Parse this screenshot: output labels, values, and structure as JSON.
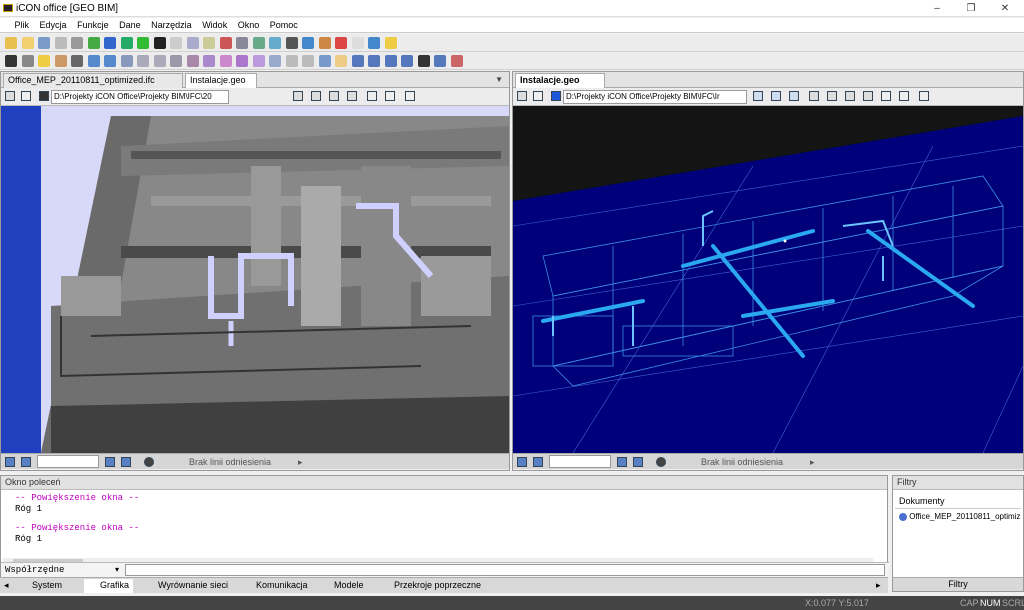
{
  "app": {
    "title": "iCON office [GEO BIM]"
  },
  "window_controls": {
    "min": "–",
    "max": "❐",
    "close": "✕"
  },
  "menu": [
    "Plik",
    "Edycja",
    "Funkcje",
    "Dane",
    "Narzędzia",
    "Widok",
    "Okno",
    "Pomoc"
  ],
  "left_panel": {
    "tabs": [
      "Office_MEP_20110811_optimized.ifc",
      "Instalacje.geo"
    ],
    "path": "D:\\Projekty iCON Office\\Projekty BIM\\IFC\\20",
    "ref_label": "Brak linii odniesienia",
    "combo": ""
  },
  "right_panel": {
    "tabs": [
      "Instalacje.geo"
    ],
    "path": "D:\\Projekty iCON Office\\Projekty BIM\\IFC\\Ir",
    "ref_label": "Brak linii odniesienia",
    "combo": ""
  },
  "command_window": {
    "title": "Okno poleceń",
    "lines": [
      {
        "text": "-- Powiększenie okna --",
        "color": "pink"
      },
      {
        "text": "Róg 1",
        "color": "black"
      },
      {
        "text": "",
        "color": "black"
      },
      {
        "text": "-- Powiększenie okna --",
        "color": "pink"
      },
      {
        "text": "Róg 1",
        "color": "black"
      }
    ],
    "coord_label": "Współrzędne",
    "input_value": ""
  },
  "bottom_tabs": [
    "System",
    "Grafika",
    "Wyrównanie sieci",
    "Komunikacja",
    "Modele",
    "Przekroje poprzeczne"
  ],
  "filters": {
    "title": "Filtry",
    "section": "Dokumenty",
    "item": "Office_MEP_20110811_optimiz",
    "tab": "Filtry"
  },
  "statusbar": {
    "coords": "X:0.077  Y:5.017",
    "cap": "CAP",
    "num": "NUM",
    "scrl": "SCRL"
  },
  "colors": {
    "viewport_left_bg": "#d8d8f8",
    "viewport_right_bg": "#00007a",
    "wire": "#2a9fe8",
    "accent": "#3a6cc8"
  }
}
